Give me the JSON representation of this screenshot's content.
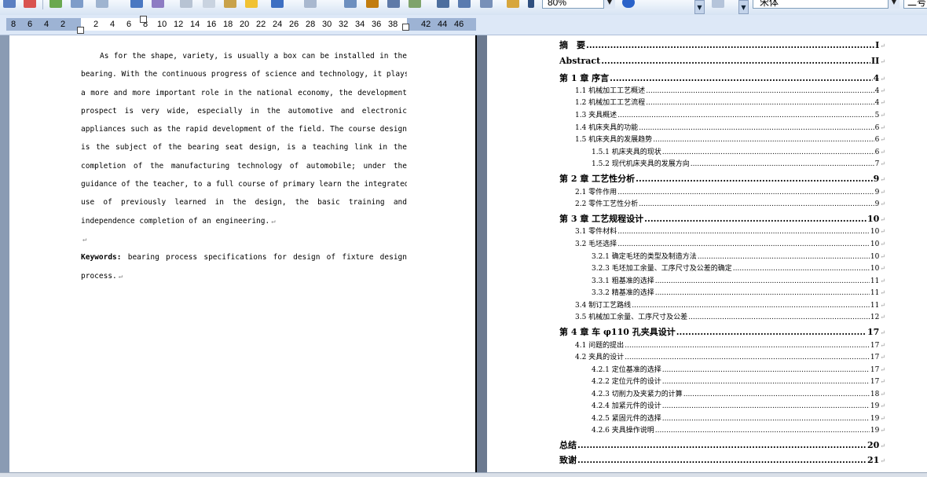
{
  "toolbar": {
    "zoom_value": "80%",
    "font_name": "宋体",
    "font_size": "二号"
  },
  "ruler": {
    "numbers": [
      "8",
      "6",
      "4",
      "2",
      "2",
      "4",
      "6",
      "8",
      "10",
      "12",
      "14",
      "16",
      "18",
      "20",
      "22",
      "24",
      "26",
      "28",
      "30",
      "32",
      "34",
      "36",
      "38",
      "42",
      "44",
      "46"
    ]
  },
  "abstract": {
    "lines": [
      "As for the shape, variety, is usually a box can be installed in the",
      "bearing. With the continuous progress of science and technology, it plays",
      "a more and more important role in the national economy, the development",
      "prospect is very wide, especially in the automotive and electronic",
      "appliances such as the rapid development of the field. The course design",
      "is the subject of the bearing seat design, is a teaching link in the",
      "completion of the manufacturing technology of automobile; under the",
      "guidance of the teacher, to a full course of primary learn the integrated",
      "use of previously learned in the design, the basic training and",
      "independence completion of an engineering."
    ],
    "paragraph_mark": "↵",
    "keywords_label": "Keywords:",
    "keywords_line1": " bearing process specifications for design of fixture design",
    "keywords_line2": "process."
  },
  "toc": [
    {
      "level": 1,
      "title": "摘　要",
      "page": "I"
    },
    {
      "level": 1,
      "title": "Abstract",
      "page": "II"
    },
    {
      "level": 1,
      "title": "第 1 章  序言",
      "page": "4"
    },
    {
      "level": 2,
      "title": "1.1  机械加工工艺概述",
      "page": "4"
    },
    {
      "level": 2,
      "title": "1.2 机械加工工艺流程",
      "page": "4"
    },
    {
      "level": 2,
      "title": "1.3 夹具概述",
      "page": "5"
    },
    {
      "level": 2,
      "title": "1.4 机床夹具的功能",
      "page": "6"
    },
    {
      "level": 2,
      "title": "1.5 机床夹具的发展趋势",
      "page": "6"
    },
    {
      "level": 3,
      "title": "1.5.1 机床夹具的现状",
      "page": "6"
    },
    {
      "level": 3,
      "title": "1.5.2 现代机床夹具的发展方向",
      "page": "7"
    },
    {
      "level": 1,
      "title": "第 2 章  工艺性分析",
      "page": "9"
    },
    {
      "level": 2,
      "title": "2.1 零件作用",
      "page": "9"
    },
    {
      "level": 2,
      "title": "2.2 零件工艺性分析",
      "page": "9"
    },
    {
      "level": 1,
      "title": "第 3 章  工艺规程设计",
      "page": "10"
    },
    {
      "level": 2,
      "title": "3.1 零件材料",
      "page": "10"
    },
    {
      "level": 2,
      "title": "3.2 毛坯选择",
      "page": "10"
    },
    {
      "level": 3,
      "title": "3.2.1 确定毛坯的类型及制造方法",
      "page": "10"
    },
    {
      "level": 3,
      "title": "3.2.3 毛坯加工余量、工序尺寸及公差的确定",
      "page": "10"
    },
    {
      "level": 3,
      "title": "3.3.1 粗基准的选择",
      "page": "11"
    },
    {
      "level": 3,
      "title": "3.3.2 精基准的选择",
      "page": "11"
    },
    {
      "level": 2,
      "title": "3.4 制订工艺路线",
      "page": "11"
    },
    {
      "level": 2,
      "title": "3.5 机械加工余量、工序尺寸及公差",
      "page": "12"
    },
    {
      "level": 1,
      "title": "第 4 章  车 φ110 孔夹具设计",
      "page": "17"
    },
    {
      "level": 2,
      "title": "4.1 问题的提出",
      "page": "17"
    },
    {
      "level": 2,
      "title": "4.2 夹具的设计",
      "page": "17"
    },
    {
      "level": 3,
      "title": "4.2.1 定位基准的选择",
      "page": "17"
    },
    {
      "level": 3,
      "title": "4.2.2 定位元件的设计",
      "page": "17"
    },
    {
      "level": 3,
      "title": "4.2.3 切削力及夹紧力的计算",
      "page": "18"
    },
    {
      "level": 3,
      "title": "4.2.4 加紧元件的设计",
      "page": "19"
    },
    {
      "level": 3,
      "title": "4.2.5 紧固元件的选择",
      "page": "19"
    },
    {
      "level": 3,
      "title": "4.2.6 夹具操作说明",
      "page": "19"
    },
    {
      "level": 1,
      "title": "总结",
      "page": "20"
    },
    {
      "level": 1,
      "title": "致谢",
      "page": "21"
    }
  ],
  "toc_mark": "↵"
}
